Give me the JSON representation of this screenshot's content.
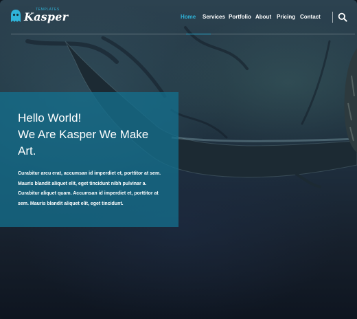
{
  "logo": {
    "word": "Kasper",
    "sub": "TEMPLATES",
    "icon": "ghost-icon",
    "accent": "#2fb4da"
  },
  "nav": {
    "items": [
      {
        "label": "Home",
        "active": true
      },
      {
        "label": "Services",
        "active": false
      },
      {
        "label": "Portfolio",
        "active": false
      },
      {
        "label": "About",
        "active": false
      },
      {
        "label": "Pricing",
        "active": false
      },
      {
        "label": "Contact",
        "active": false
      }
    ],
    "search_icon": "search-icon"
  },
  "hero": {
    "title_line1": "Hello World!",
    "title_line2": "We Are Kasper We Make",
    "title_line3": "Art.",
    "text": "Curabitur arcu erat, accumsan id imperdiet et, porttitor at sem. Mauris blandit aliquet elit, eget tincidunt nibh pulvinar a. Curabitur aliquet quam. Accumsan id imperdiet et, porttitor at sem. Mauris blandit aliquet elit, eget tincidunt.",
    "box_color": "#146e8c"
  }
}
